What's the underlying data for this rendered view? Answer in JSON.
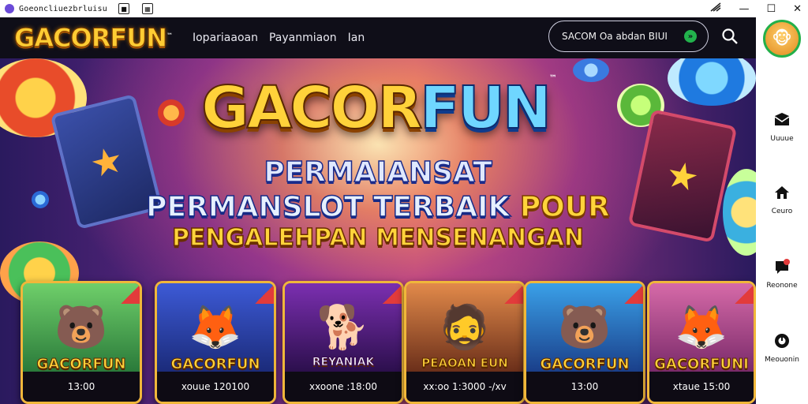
{
  "titlebar": {
    "title": "Goeoncliuezbrluisu"
  },
  "header": {
    "logo": "GACORFUN",
    "logo_tm": "™",
    "nav": [
      "Iopariaaoan",
      "Payanmiaon",
      "Ian"
    ],
    "search_placeholder": "SACOM Oa abdan BIUI",
    "search_go": "»"
  },
  "hero": {
    "logo_gacor": "GACOR",
    "logo_fun": "FUN",
    "logo_tm": "™",
    "line1": "PERMAIANSAT",
    "line2_a": "PERMANSLOT TERBAIK",
    "line2_b": "POUR",
    "line3": "PENGALEHPAN MENSENANGAN"
  },
  "games": [
    {
      "name": "GACORFUN",
      "footer": "13:00",
      "emoji": "🐻",
      "bg": "linear-gradient(180deg,#6fcf6a,#2a7a3a)"
    },
    {
      "name": "GACORFUN",
      "footer": "xouue 120100",
      "emoji": "🦊",
      "bg": "linear-gradient(180deg,#3d5ad6,#1b2b7a)"
    },
    {
      "name": "REYANIAK",
      "footer": "xxoone :18:00",
      "emoji": "🐕",
      "bg": "linear-gradient(180deg,#7b2fb0,#2c0f4d)"
    },
    {
      "name": "PEAOAN EUN",
      "footer": "xx:oo 1:3000 -/xv",
      "emoji": "🧔",
      "bg": "linear-gradient(180deg,#e28a4a,#6b2f1a)"
    },
    {
      "name": "GACORFUN",
      "footer": "13:00",
      "emoji": "🐻",
      "bg": "linear-gradient(180deg,#3aa0e8,#1a3f8a)"
    },
    {
      "name": "GACORFUNI",
      "footer": "xtaue 15:00",
      "emoji": "🦊",
      "bg": "linear-gradient(180deg,#d66aa8,#7a2a6a)"
    }
  ],
  "sidebar": {
    "avatar": "🐵",
    "items": [
      {
        "label": "Uuuue",
        "icon": "mail-icon"
      },
      {
        "label": "Ceuro",
        "icon": "home-icon"
      },
      {
        "label": "Reonone",
        "icon": "alert-icon"
      },
      {
        "label": "Meouonin",
        "icon": "circle-icon"
      }
    ]
  }
}
